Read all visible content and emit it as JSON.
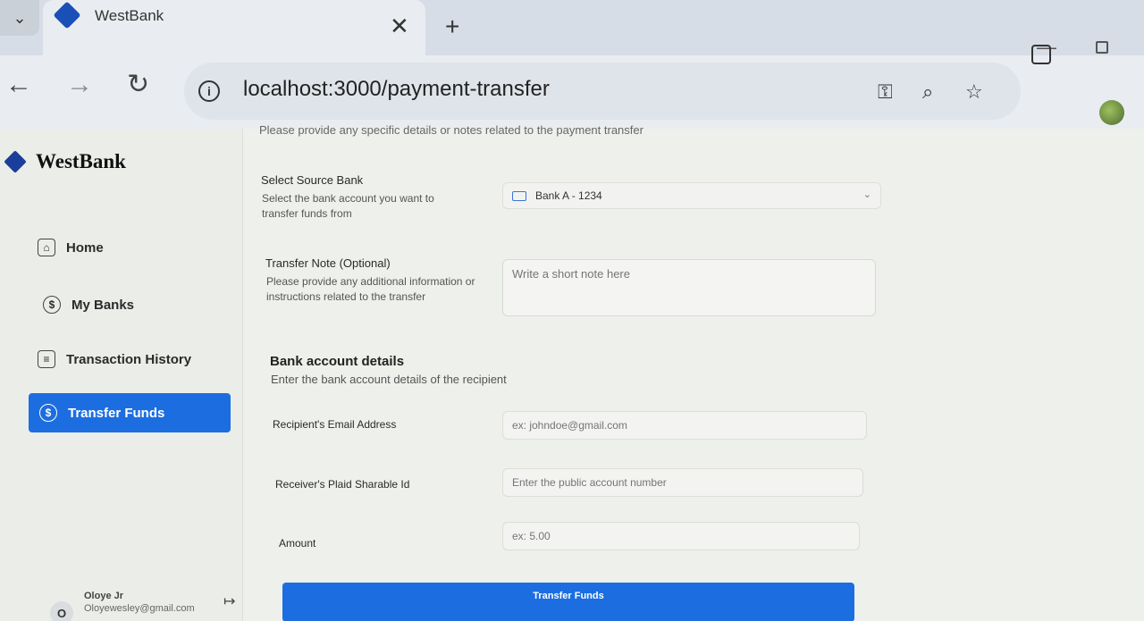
{
  "browser": {
    "tab_title": "WestBank",
    "url": "localhost:3000/payment-transfer"
  },
  "sidebar": {
    "brand": "WestBank",
    "items": [
      {
        "label": "Home"
      },
      {
        "label": "My Banks"
      },
      {
        "label": "Transaction History"
      },
      {
        "label": "Transfer Funds",
        "active": true
      }
    ],
    "user": {
      "initial": "O",
      "name": "Oloye Jr",
      "email": "Oloyewesley@gmail.com"
    }
  },
  "form": {
    "cut_off_text": "Please provide any specific details or notes related to the payment transfer",
    "source_bank": {
      "label": "Select Source Bank",
      "help": "Select the bank account you want to transfer funds from",
      "selected": "Bank A - 1234"
    },
    "note": {
      "label": "Transfer Note (Optional)",
      "help": "Please provide any additional information or instructions related to the transfer",
      "placeholder": "Write a short note here"
    },
    "bank_details": {
      "title": "Bank account details",
      "subtitle": "Enter the bank account details of the recipient"
    },
    "email": {
      "label": "Recipient's Email Address",
      "placeholder": "ex: johndoe@gmail.com"
    },
    "plaid_id": {
      "label": "Receiver's Plaid Sharable Id",
      "placeholder": "Enter the public account number"
    },
    "amount": {
      "label": "Amount",
      "placeholder": "ex: 5.00"
    },
    "submit_label": "Transfer Funds"
  },
  "colors": {
    "accent": "#1c6ee0",
    "brand": "#1a3e9a"
  }
}
